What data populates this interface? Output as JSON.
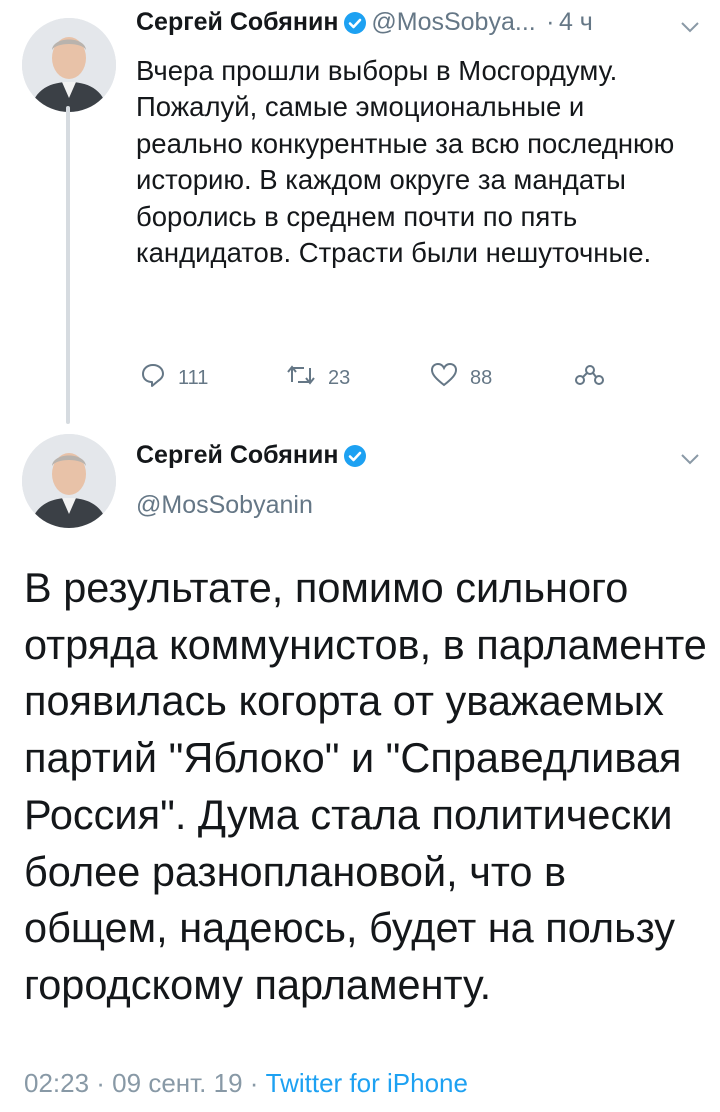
{
  "tweet1": {
    "author_name": "Сергей Собянин",
    "handle": "@MosSobya...",
    "separator": "·",
    "time": "4 ч",
    "text": "Вчера прошли выборы в Мосгордуму. Пожалуй, самые эмоциональные и реально конкурентные за всю последнюю историю. В каждом округе за мандаты боролись в среднем почти по пять кандидатов. Страсти были нешуточные.",
    "replies": "111",
    "retweets": "23",
    "likes": "88"
  },
  "tweet2": {
    "author_name": "Сергей Собянин",
    "handle": "@MosSobyanin",
    "text": "В результате, помимо сильного отряда коммунистов, в парламенте появилась когорта от уважаемых партий \"Яблоко\" и \"Справедливая Россия\". Дума стала политически более разноплановой, что в общем, надеюсь, будет на пользу городскому парламенту.",
    "timestamp": "02:23 · 09 сент. 19 · ",
    "source": "Twitter for iPhone"
  },
  "colors": {
    "verified": "#1da1f2",
    "muted": "#657786",
    "link": "#1da1f2",
    "thread_line": "#d6dbe0"
  },
  "icons": [
    "verified-icon",
    "chevron-down-icon",
    "reply-icon",
    "retweet-icon",
    "like-icon",
    "share-icon"
  ]
}
